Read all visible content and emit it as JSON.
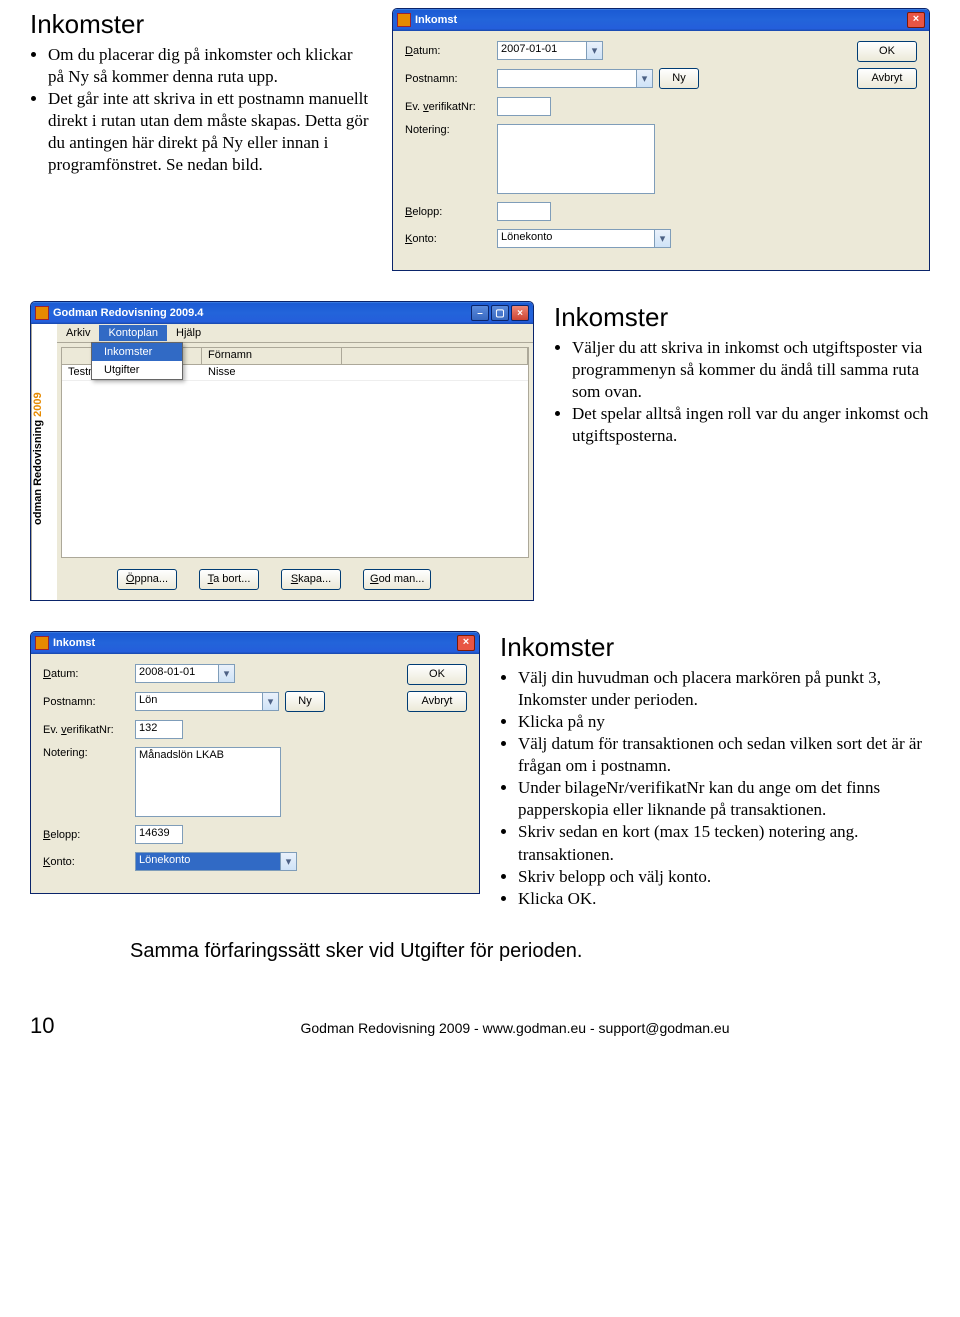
{
  "section1": {
    "heading": "Inkomster",
    "bullets": [
      "Om du placerar dig på inkomster och klickar på Ny så kommer denna ruta upp.",
      "Det går inte att skriva in ett postnamn manuellt direkt i rutan utan dem måste skapas. Detta gör du antingen här direkt på Ny eller innan i programfönstret. Se nedan bild."
    ]
  },
  "dialog1": {
    "title": "Inkomst",
    "labels": {
      "datum": "Datum:",
      "postnamn": "Postnamn:",
      "verifikat": "Ev. verifikatNr:",
      "notering": "Notering:",
      "belopp": "Belopp:",
      "konto": "Konto:"
    },
    "values": {
      "datum": "2007-01-01",
      "konto": "Lönekonto"
    },
    "buttons": {
      "ok": "OK",
      "ny": "Ny",
      "avbryt": "Avbryt"
    }
  },
  "section2": {
    "heading": "Inkomster",
    "bullets": [
      "Väljer du att skriva in inkomst och utgiftsposter via programmenyn så kommer du ändå till samma ruta som ovan.",
      "Det spelar alltså ingen roll var du anger inkomst och utgiftsposterna."
    ]
  },
  "app": {
    "title": "Godman Redovisning 2009.4",
    "sidebar": "odman Redovisning",
    "sidebar_year": "2009",
    "menu": [
      "Arkiv",
      "Kontoplan",
      "Hjälp"
    ],
    "submenu": [
      "Inkomster",
      "Utgifter"
    ],
    "columns": {
      "c2": "Förnamn"
    },
    "row": {
      "c1": "Testman",
      "c2": "Nisse"
    },
    "buttons": {
      "oppna": "Öppna...",
      "tabort": "Ta bort...",
      "skapa": "Skapa...",
      "godman": "God man..."
    }
  },
  "dialog2": {
    "title": "Inkomst",
    "labels": {
      "datum": "Datum:",
      "postnamn": "Postnamn:",
      "verifikat": "Ev. verifikatNr:",
      "notering": "Notering:",
      "belopp": "Belopp:",
      "konto": "Konto:"
    },
    "values": {
      "datum": "2008-01-01",
      "postnamn": "Lön",
      "verifikat": "132",
      "notering": "Månadslön LKAB",
      "belopp": "14639",
      "konto": "Lönekonto"
    },
    "buttons": {
      "ok": "OK",
      "ny": "Ny",
      "avbryt": "Avbryt"
    }
  },
  "section3": {
    "heading": "Inkomster",
    "bullets": [
      "Välj din huvudman och placera markören på punkt 3, Inkomster under perioden.",
      "Klicka på ny",
      "Välj datum för transaktionen och sedan vilken sort det är är frågan om i postnamn.",
      "Under bilageNr/verifikatNr kan du ange om det finns papperskopia eller liknande på transaktionen.",
      "Skriv sedan en kort (max 15 tecken) notering ang. transaktionen.",
      "Skriv belopp och välj konto.",
      "Klicka OK."
    ]
  },
  "summary": "Samma förfaringssätt sker vid Utgifter för perioden.",
  "footer": {
    "page": "10",
    "text": "Godman Redovisning 2009 - www.godman.eu - support@godman.eu"
  }
}
